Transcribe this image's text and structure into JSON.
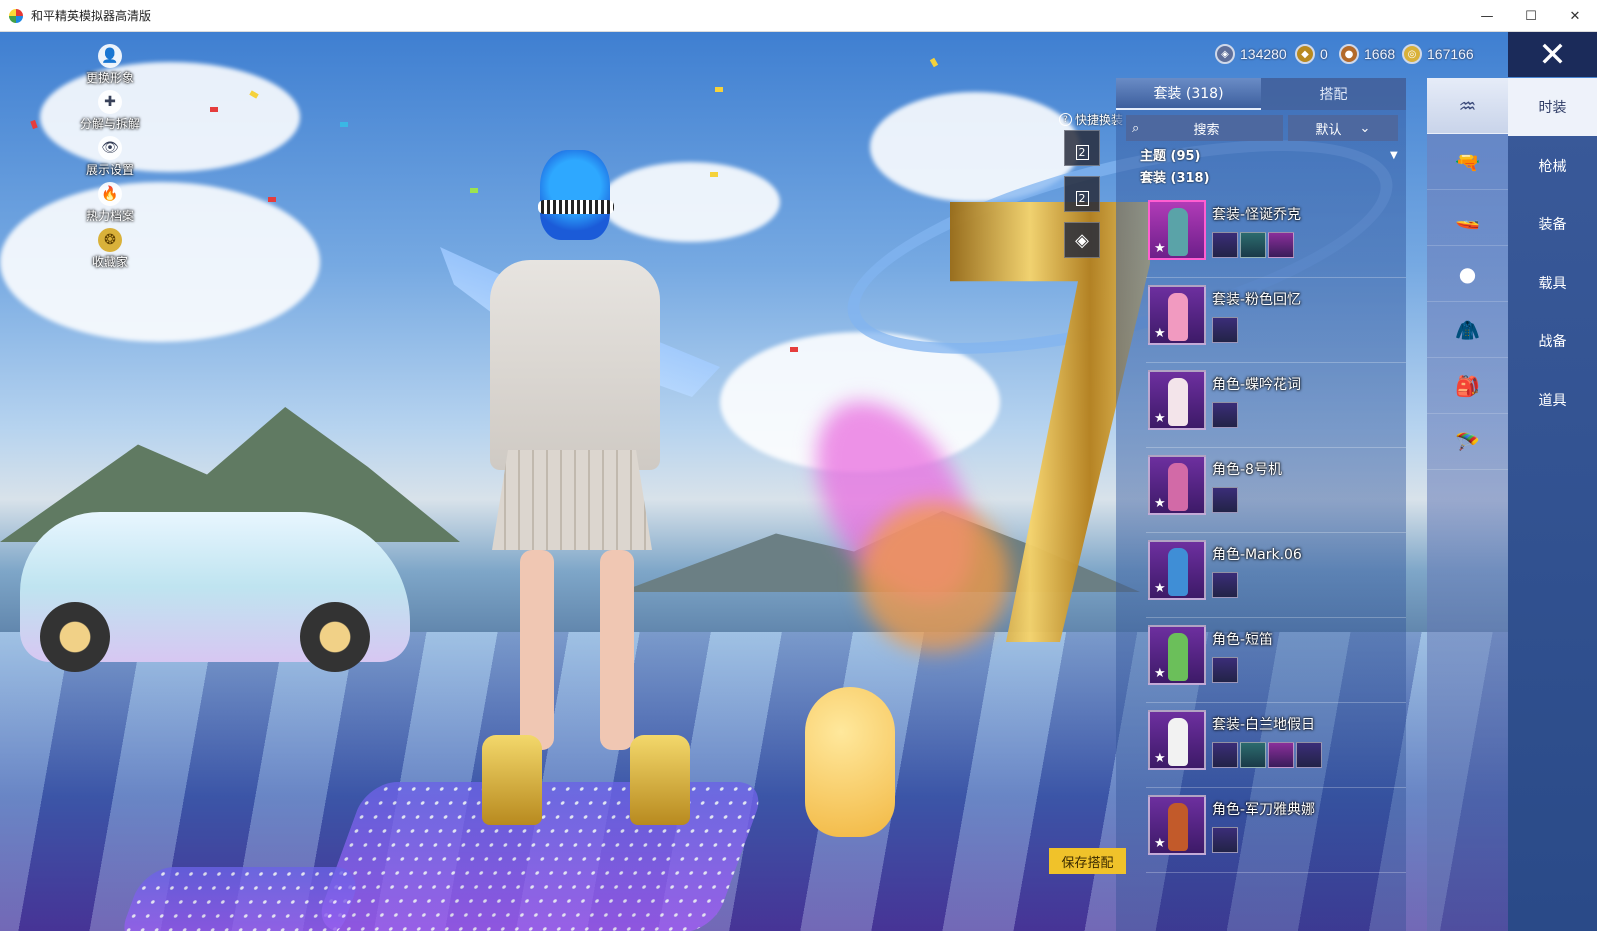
{
  "window": {
    "title": "和平精英模拟器高清版",
    "minimize": "—",
    "maximize": "☐",
    "close": "✕"
  },
  "left_menu": [
    {
      "label": "更换形象",
      "icon": "person-icon",
      "glyph": "👤"
    },
    {
      "label": "分解与拆解",
      "icon": "puzzle-icon",
      "glyph": "✚"
    },
    {
      "label": "展示设置",
      "icon": "eye-icon",
      "glyph": "👁"
    },
    {
      "label": "热力档案",
      "icon": "flame-icon",
      "glyph": "🔥"
    },
    {
      "label": "收藏家",
      "icon": "collector-badge-icon",
      "glyph": "❂"
    }
  ],
  "currency": [
    {
      "value": "134280",
      "icon": "silver-coin-icon",
      "color": "#5f6f9a"
    },
    {
      "value": "0",
      "icon": "gold-token-icon",
      "color": "#b88a20"
    },
    {
      "value": "1668",
      "icon": "bronze-coin-icon",
      "color": "#b36a2a"
    },
    {
      "value": "167166",
      "icon": "gold-coin-icon",
      "color": "#d9b13a"
    }
  ],
  "close_button": "✕",
  "quick_change": {
    "help": "?",
    "label": "快捷换装",
    "slots": [
      "2",
      "2"
    ]
  },
  "panel": {
    "tabs": [
      {
        "label": "套装 (318)",
        "active": true
      },
      {
        "label": "搭配",
        "active": false
      }
    ],
    "search": {
      "icon": "⌕",
      "placeholder": "搜索"
    },
    "sort": {
      "label": "默认",
      "chevron": "⌄"
    },
    "filters": [
      "主题 (95)",
      "套装 (318)"
    ],
    "filter_arrow": "▼",
    "items": [
      {
        "name": "套装-怪诞乔克",
        "selected": true,
        "fig_color": "#5aa3a8",
        "subs": 3
      },
      {
        "name": "套装-粉色回忆",
        "selected": false,
        "fig_color": "#f19ac0",
        "subs": 1
      },
      {
        "name": "角色-蝶吟花词",
        "selected": false,
        "fig_color": "#f3e4ea",
        "subs": 1
      },
      {
        "name": "角色-8号机",
        "selected": false,
        "fig_color": "#d26aa7",
        "subs": 1
      },
      {
        "name": "角色-Mark.06",
        "selected": false,
        "fig_color": "#3f8ed6",
        "subs": 1
      },
      {
        "name": "角色-短笛",
        "selected": false,
        "fig_color": "#6bbf5a",
        "subs": 1
      },
      {
        "name": "套装-白兰地假日",
        "selected": false,
        "fig_color": "#f2f2f2",
        "subs": 4
      },
      {
        "name": "角色-军刀雅典娜",
        "selected": false,
        "fig_color": "#c25a2a",
        "subs": 1
      }
    ],
    "star": "★",
    "save_button": "保存搭配"
  },
  "icon_column": [
    {
      "icon": "fashion-wardrobe-icon",
      "glyph": "♒",
      "active": true
    },
    {
      "icon": "weapon-skin-icon",
      "glyph": "🔫",
      "active": false
    },
    {
      "icon": "vehicle-skin-icon",
      "glyph": "🚤",
      "active": false
    },
    {
      "icon": "red-ball-icon",
      "glyph": "●",
      "active": false
    },
    {
      "icon": "jacket-icon",
      "glyph": "🧥",
      "active": false
    },
    {
      "icon": "backpack-icon",
      "glyph": "🎒",
      "active": false
    },
    {
      "icon": "glider-icon",
      "glyph": "🪂",
      "active": false
    }
  ],
  "categories": [
    {
      "label": "时装",
      "active": true
    },
    {
      "label": "枪械",
      "active": false
    },
    {
      "label": "装备",
      "active": false
    },
    {
      "label": "载具",
      "active": false
    },
    {
      "label": "战备",
      "active": false
    },
    {
      "label": "道具",
      "active": false
    }
  ],
  "colors": {
    "save_button": "#f0c22a",
    "selected_border": "#ff5ed1",
    "close_bg": "#1b2b5a"
  }
}
